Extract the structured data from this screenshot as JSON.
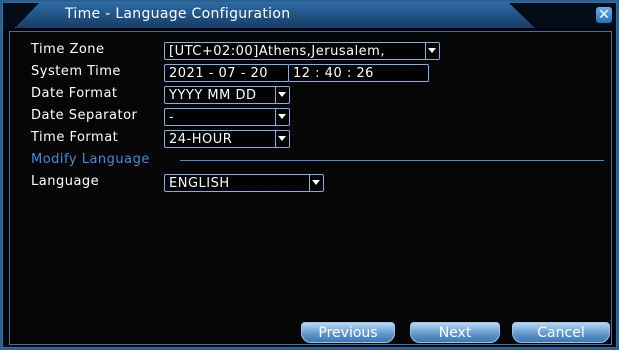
{
  "dialog": {
    "title": "Time - Language Configuration",
    "close_icon": "close-icon"
  },
  "fields": {
    "time_zone": {
      "label": "Time Zone",
      "value": "[UTC+02:00]Athens,Jerusalem,"
    },
    "system_time": {
      "label": "System Time",
      "date": "2021 - 07 - 20",
      "time": "12 : 40 : 26"
    },
    "date_format": {
      "label": "Date Format",
      "value": "YYYY MM DD"
    },
    "date_separator": {
      "label": "Date Separator",
      "value": "-"
    },
    "time_format": {
      "label": "Time Format",
      "value": "24-HOUR"
    }
  },
  "language_section": {
    "title": "Modify Language",
    "language": {
      "label": "Language",
      "value": "ENGLISH"
    }
  },
  "buttons": {
    "previous": "Previous",
    "next": "Next",
    "cancel": "Cancel"
  },
  "colors": {
    "background": "#2a5f8e",
    "accent": "#3f8ed6",
    "panel": "#050505"
  }
}
